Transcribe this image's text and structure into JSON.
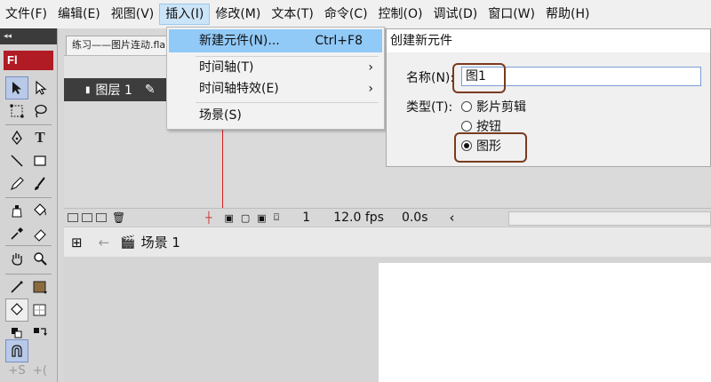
{
  "menubar": {
    "items": [
      "文件(F)",
      "编辑(E)",
      "视图(V)",
      "插入(I)",
      "修改(M)",
      "文本(T)",
      "命令(C)",
      "控制(O)",
      "调试(D)",
      "窗口(W)",
      "帮助(H)"
    ],
    "active_index": 3
  },
  "document": {
    "tab_title": "练习——图片连动.fla"
  },
  "tools_panel": {
    "logo": "Fl"
  },
  "insert_menu": {
    "items": [
      {
        "label": "新建元件(N)...",
        "shortcut": "Ctrl+F8",
        "highlighted": true
      },
      {
        "label": "时间轴(T)",
        "submenu": true
      },
      {
        "label": "时间轴特效(E)",
        "submenu": true
      },
      {
        "label": "场景(S)"
      }
    ]
  },
  "timeline": {
    "layer_name": "图层 1",
    "frame": "1",
    "fps": "12.0 fps",
    "time": "0.0s"
  },
  "edit_bar": {
    "scene_label": "场景 1"
  },
  "dialog": {
    "title": "创建新元件",
    "name_label": "名称(N):",
    "name_value": "图1",
    "type_label": "类型(T):",
    "type_options": [
      "影片剪辑",
      "按钮",
      "图形"
    ],
    "selected_type_index": 2
  },
  "colors": {
    "menu_highlight": "#91c9f7",
    "flash_logo": "#b01b24",
    "layer_row": "#3d3d3d",
    "annotation": "#7a3b1e"
  }
}
